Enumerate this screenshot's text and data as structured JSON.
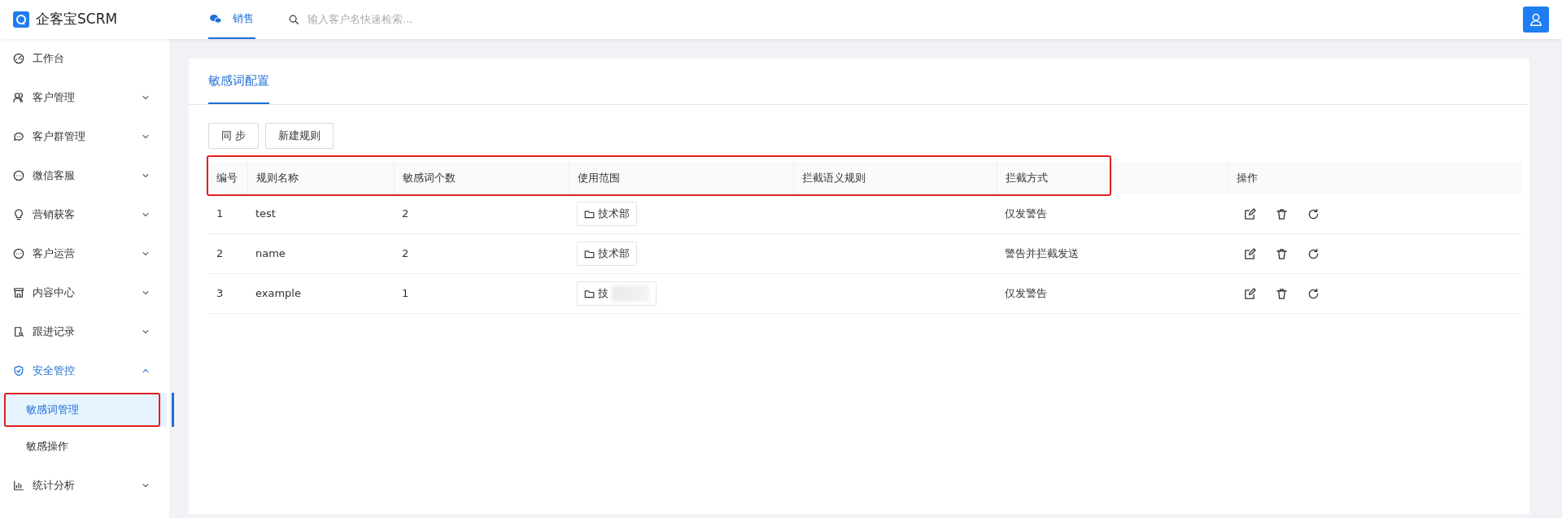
{
  "brand": {
    "name": "企客宝SCRM"
  },
  "top_tabs": [
    {
      "label": "销售",
      "selected": true
    }
  ],
  "search": {
    "placeholder": "输入客户名快速检索..."
  },
  "sidebar": {
    "items": [
      {
        "label": "工作台",
        "selected": false
      },
      {
        "label": "客户管理",
        "expanded": false,
        "selected": false
      },
      {
        "label": "客户群管理",
        "expanded": false,
        "selected": false
      },
      {
        "label": "微信客服",
        "expanded": false,
        "selected": false
      },
      {
        "label": "营销获客",
        "expanded": false,
        "selected": false
      },
      {
        "label": "客户运营",
        "expanded": false,
        "selected": false
      },
      {
        "label": "内容中心",
        "expanded": false,
        "selected": false
      },
      {
        "label": "跟进记录",
        "expanded": false,
        "selected": false
      },
      {
        "label": "安全管控",
        "expanded": true,
        "selected": true,
        "children": [
          {
            "label": "敏感词管理",
            "selected": true,
            "highlighted": true
          },
          {
            "label": "敏感操作",
            "selected": false,
            "highlighted": false
          }
        ]
      },
      {
        "label": "统计分析",
        "expanded": false,
        "selected": false
      }
    ]
  },
  "page_tabs": [
    {
      "label": "敏感词配置",
      "selected": true
    }
  ],
  "buttons": [
    "同 步",
    "新建规则"
  ],
  "table": {
    "header_highlighted": true,
    "columns": [
      "编号",
      "规则名称",
      "敏感词个数",
      "使用范围",
      "拦截语义规则",
      "拦截方式",
      "操作"
    ],
    "rows": [
      {
        "cells": [
          "1",
          "test",
          "2"
        ],
        "scope": "技术部",
        "scope_blurred": false,
        "method": "仅发警告"
      },
      {
        "cells": [
          "2",
          "name",
          "2"
        ],
        "scope": "技术部",
        "scope_blurred": false,
        "method": "警告并拦截发送"
      },
      {
        "cells": [
          "3",
          "example",
          "1"
        ],
        "scope": "技",
        "scope_blurred": true,
        "method": "仅发警告"
      }
    ]
  }
}
